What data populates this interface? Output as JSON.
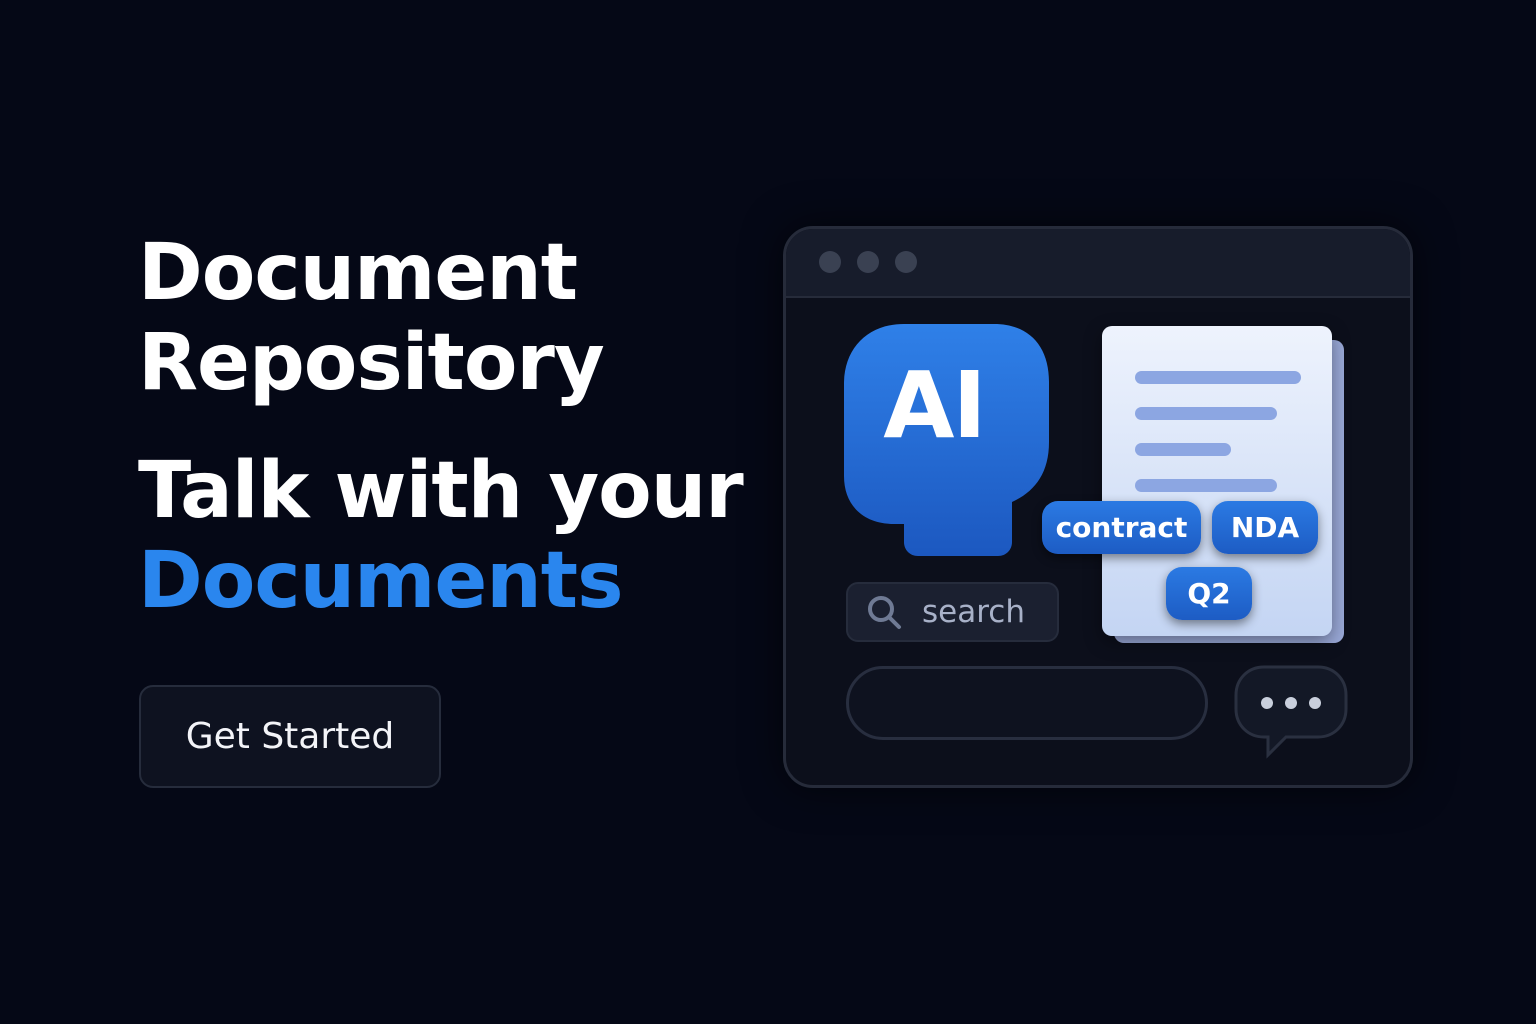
{
  "hero": {
    "title_line1": "Document",
    "title_line2": "Repository",
    "tagline_line1": "Talk with your",
    "tagline_accent": "Documents",
    "cta_label": "Get Started"
  },
  "illustration": {
    "ai_label": "AI",
    "search_placeholder": "search",
    "tags": [
      "contract",
      "NDA",
      "Q2"
    ],
    "icons": [
      "ai-head-icon",
      "document-icon",
      "search-icon",
      "chat-bubble-icon"
    ]
  },
  "colors": {
    "background": "#050816",
    "accent": "#2a86ee",
    "tag_blue": "#1d5cc4"
  }
}
